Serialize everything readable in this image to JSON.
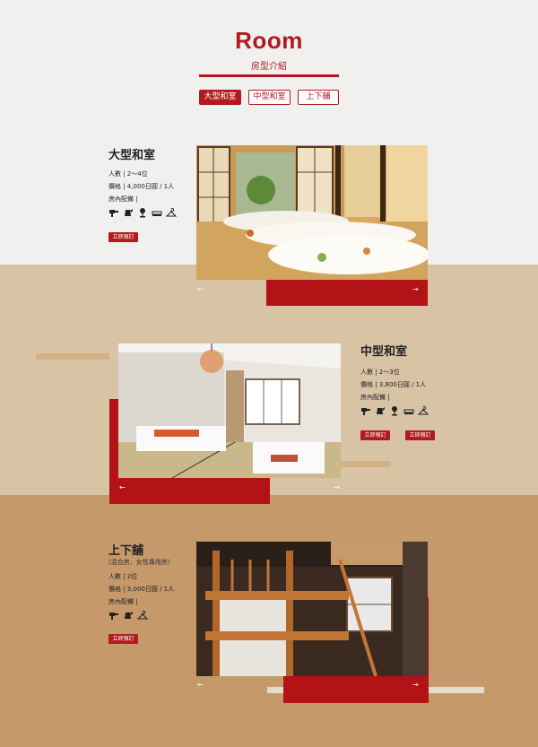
{
  "header": {
    "title": "Room",
    "subtitle": "房型介紹"
  },
  "tabs": [
    {
      "label": "大型和室",
      "active": true
    },
    {
      "label": "中型和室",
      "active": false
    },
    {
      "label": "上下舖",
      "active": false
    }
  ],
  "rooms": [
    {
      "name": "大型和室",
      "capacity": "人數 | 2～4位",
      "price": "價格 | 4,000日圓 / 1人",
      "amenities_label": "房內配備 |",
      "amenities": [
        "hairdryer-icon",
        "kettle-icon",
        "lamp-icon",
        "futon-icon",
        "hanger-icon"
      ],
      "buttons": [
        "立即預訂"
      ]
    },
    {
      "name": "中型和室",
      "capacity": "人數 | 2～3位",
      "price": "價格 | 3,800日圓 / 1人",
      "amenities_label": "房內配備 |",
      "amenities": [
        "hairdryer-icon",
        "kettle-icon",
        "lamp-icon",
        "futon-icon",
        "hanger-icon"
      ],
      "buttons": [
        "立即預訂",
        "立即預訂"
      ]
    },
    {
      "name": "上下舖",
      "note": "(混合房．女性專用房)",
      "capacity": "人數 | 2位",
      "price": "價格 | 3,000日圓 / 1人",
      "amenities_label": "房內配備 |",
      "amenities": [
        "hairdryer-icon",
        "kettle-icon",
        "hanger-icon"
      ],
      "buttons": [
        "立即預訂"
      ]
    }
  ],
  "carousel": {
    "prev": "←",
    "next": "→"
  },
  "colors": {
    "accent": "#b21a1f",
    "band_top": "#f0f0ef",
    "band_mid": "#d8c3a5",
    "band_bottom": "#c5996a"
  }
}
